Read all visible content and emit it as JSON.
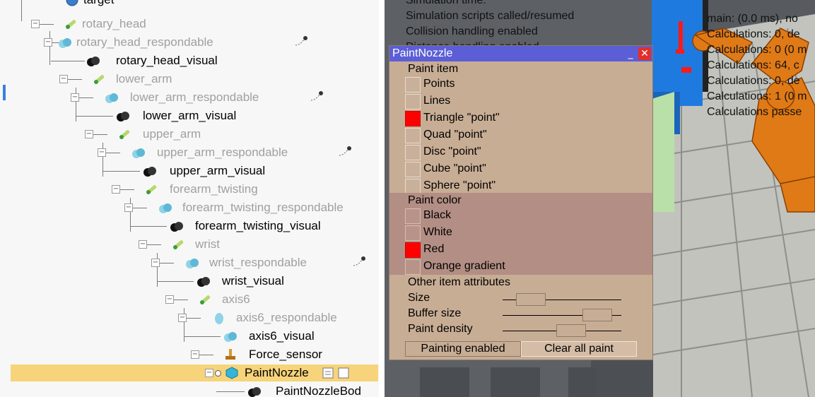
{
  "tree": {
    "rows": [
      {
        "label": "target",
        "dim": false
      },
      {
        "label": "rotary_head",
        "dim": true
      },
      {
        "label": "rotary_head_respondable",
        "dim": true
      },
      {
        "label": "rotary_head_visual",
        "dim": false
      },
      {
        "label": "lower_arm",
        "dim": true
      },
      {
        "label": "lower_arm_respondable",
        "dim": true
      },
      {
        "label": "lower_arm_visual",
        "dim": false
      },
      {
        "label": "upper_arm",
        "dim": true
      },
      {
        "label": "upper_arm_respondable",
        "dim": true
      },
      {
        "label": "upper_arm_visual",
        "dim": false
      },
      {
        "label": "forearm_twisting",
        "dim": true
      },
      {
        "label": "forearm_twisting_respondable",
        "dim": true
      },
      {
        "label": "forearm_twisting_visual",
        "dim": false
      },
      {
        "label": "wrist",
        "dim": true
      },
      {
        "label": "wrist_respondable",
        "dim": true
      },
      {
        "label": "wrist_visual",
        "dim": false
      },
      {
        "label": "axis6",
        "dim": true
      },
      {
        "label": "axis6_respondable",
        "dim": true
      },
      {
        "label": "axis6_visual",
        "dim": false
      },
      {
        "label": "Force_sensor",
        "dim": false
      },
      {
        "label": "PaintNozzle",
        "dim": false
      },
      {
        "label": "PaintNozzleBod",
        "dim": false
      }
    ]
  },
  "view": {
    "info_left": [
      "Simulation time:",
      "Simulation scripts called/resumed",
      "Collision handling enabled",
      "Distance handling enabled"
    ],
    "info_right": [
      "main: (0.0 ms), no",
      "Calculations: 0, de",
      "Calculations: 0 (0 m",
      "Calculations: 64, c",
      "Calculations: 0, de",
      "Calculations: 1 (0 m",
      "Calculations passe"
    ]
  },
  "dialog": {
    "title": "PaintNozzle",
    "paint_item": {
      "label": "Paint item",
      "options": [
        {
          "label": "Points",
          "on": false
        },
        {
          "label": "Lines",
          "on": false
        },
        {
          "label": "Triangle \"point\"",
          "on": true
        },
        {
          "label": "Quad \"point\"",
          "on": false
        },
        {
          "label": "Disc \"point\"",
          "on": false
        },
        {
          "label": "Cube \"point\"",
          "on": false
        },
        {
          "label": "Sphere \"point\"",
          "on": false
        }
      ]
    },
    "paint_color": {
      "label": "Paint color",
      "options": [
        {
          "label": "Black",
          "on": false
        },
        {
          "label": "White",
          "on": false
        },
        {
          "label": "Red",
          "on": true
        },
        {
          "label": "Orange gradient",
          "on": false
        }
      ]
    },
    "other": {
      "label": "Other item attributes",
      "size_label": "Size",
      "size_value": 0.15,
      "buffer_label": "Buffer size",
      "buffer_value": 0.9,
      "density_label": "Paint density",
      "density_value": 0.6
    },
    "painting_enabled_label": "Painting enabled",
    "clear_label": "Clear all paint"
  }
}
